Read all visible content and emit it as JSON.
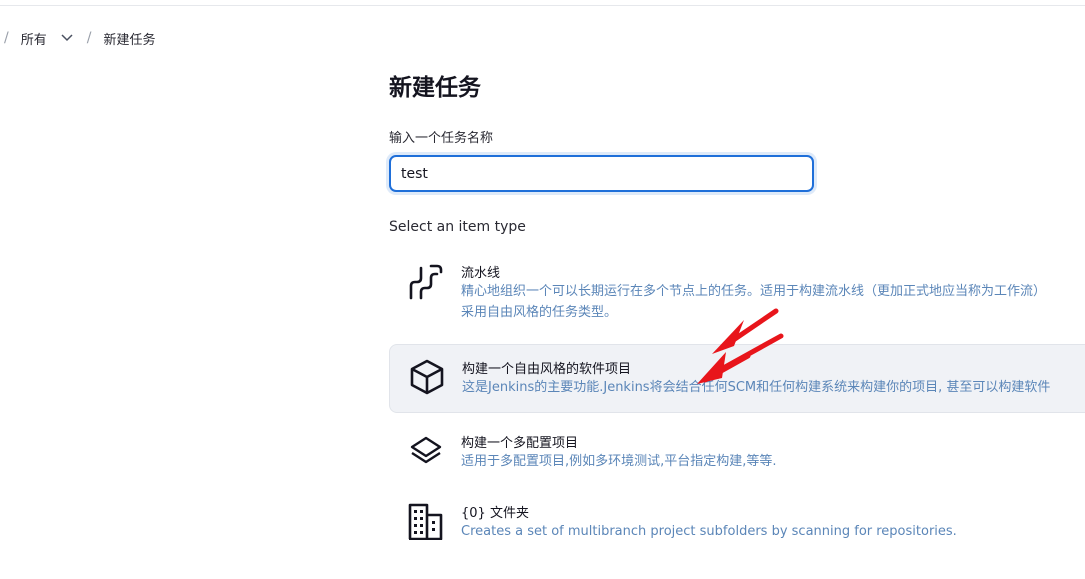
{
  "breadcrumb": {
    "items": [
      "所有",
      "新建任务"
    ]
  },
  "page": {
    "title": "新建任务",
    "name_label": "输入一个任务名称",
    "name_value": "test",
    "type_label": "Select an item type"
  },
  "item_types": [
    {
      "icon": "pipeline-icon",
      "title": "流水线",
      "desc_line1": "精心地组织一个可以长期运行在多个节点上的任务。适用于构建流水线（更加正式地应当称为工作流）",
      "desc_line2": "采用自由风格的任务类型。"
    },
    {
      "icon": "cube-icon",
      "title": "构建一个自由风格的软件项目",
      "desc_line1": "这是Jenkins的主要功能.Jenkins将会结合任何SCM和任何构建系统来构建你的项目, 甚至可以构建软件"
    },
    {
      "icon": "layers-icon",
      "title": "构建一个多配置项目",
      "desc_line1": "适用于多配置项目,例如多环境测试,平台指定构建,等等."
    },
    {
      "icon": "building-icon",
      "title": "{0} 文件夹",
      "desc_line1": "Creates a set of multibranch project subfolders by scanning for repositories."
    }
  ],
  "colors": {
    "accent": "#1f6fd9",
    "description": "#5b86b8",
    "selected_bg": "#f0f2f6",
    "annotation": "#e8151b"
  }
}
